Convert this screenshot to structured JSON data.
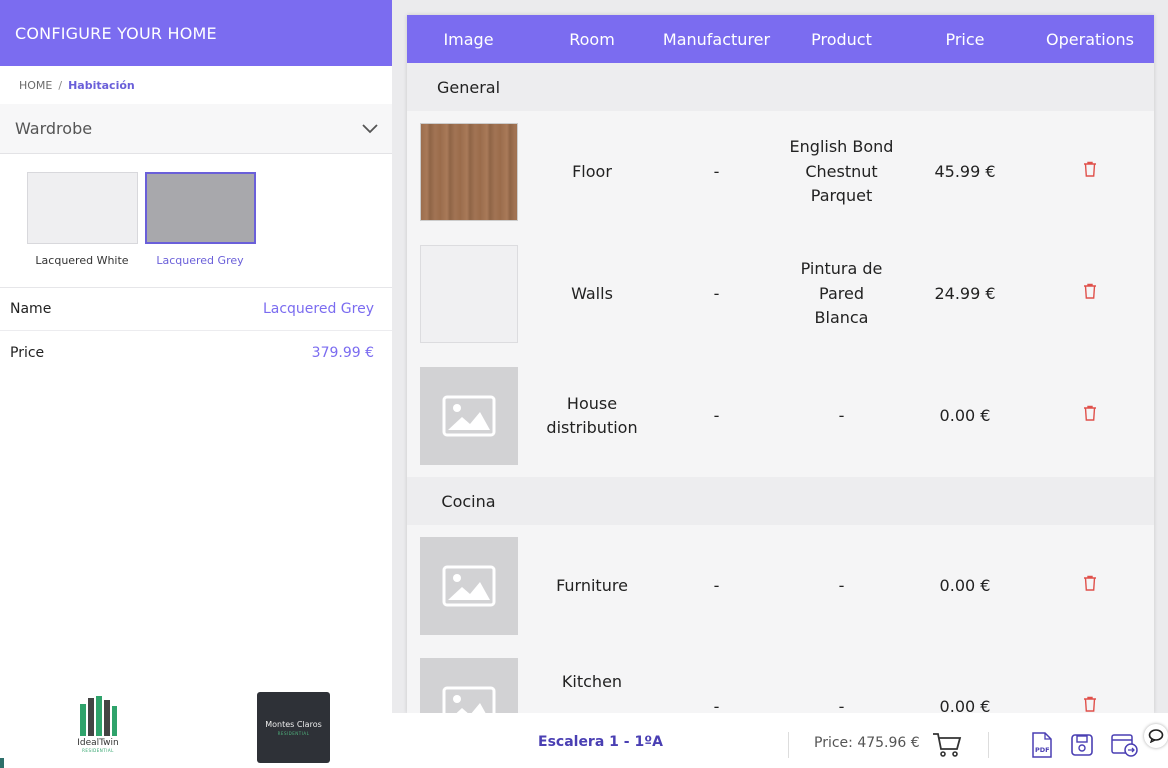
{
  "left": {
    "title": "CONFIGURE YOUR HOME",
    "breadcrumb": {
      "home": "HOME",
      "separator": "/",
      "current": "Habitación"
    },
    "category": "Wardrobe",
    "swatches": [
      {
        "label": "Lacquered White",
        "color": "#efeff1",
        "selected": false
      },
      {
        "label": "Lacquered Grey",
        "color": "#a8a8ac",
        "selected": true
      }
    ],
    "props": {
      "name_key": "Name",
      "name_val": "Lacquered Grey",
      "price_key": "Price",
      "price_val": "379.99 €"
    },
    "logos": {
      "idealtwin_name": "IdealTwin",
      "idealtwin_sub": "RESIDENTIAL",
      "montes_name": "Montes Claros",
      "montes_sub": "RESIDENTIAL"
    }
  },
  "table": {
    "headers": [
      "Image",
      "Room",
      "Manufacturer",
      "Product",
      "Price",
      "Operations"
    ],
    "groups": [
      {
        "name": "General",
        "rows": [
          {
            "image": "wood",
            "room": "Floor",
            "manufacturer": "-",
            "product": "English Bond Chestnut Parquet",
            "price": "45.99 €"
          },
          {
            "image": "white",
            "room": "Walls",
            "manufacturer": "-",
            "product": "Pintura de Pared Blanca",
            "price": "24.99 €"
          },
          {
            "image": "placeholder",
            "room": "House distribution",
            "manufacturer": "-",
            "product": "-",
            "price": "0.00 €"
          }
        ]
      },
      {
        "name": "Cocina",
        "rows": [
          {
            "image": "placeholder",
            "room": "Furniture",
            "manufacturer": "-",
            "product": "-",
            "price": "0.00 €"
          },
          {
            "image": "placeholder",
            "room": "Kitchen",
            "manufacturer": "-",
            "product": "-",
            "price": "0.00 €"
          }
        ]
      }
    ]
  },
  "footer": {
    "staircase": "Escalera 1 - 1ºA",
    "price": "Price: 475.96 €"
  },
  "colors": {
    "accent": "#7b6cf0",
    "delete": "#e0504a"
  }
}
